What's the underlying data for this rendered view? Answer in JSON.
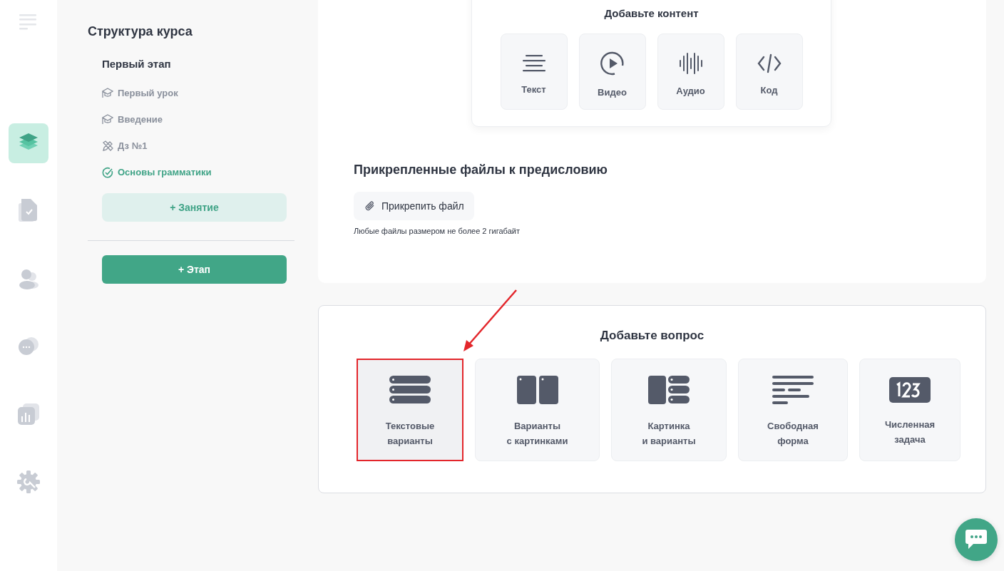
{
  "nav": [
    {
      "kind": "menu",
      "selected": false
    },
    {
      "kind": "layers",
      "selected": true
    },
    {
      "kind": "document",
      "selected": false
    },
    {
      "kind": "users",
      "selected": false
    },
    {
      "kind": "chat",
      "selected": false
    },
    {
      "kind": "chart",
      "selected": false
    },
    {
      "kind": "settings",
      "selected": false
    }
  ],
  "structure": {
    "title": "Структура курса",
    "stage": "Первый этап",
    "lessons": [
      {
        "kind": "lesson",
        "label": "Первый урок",
        "selected": false
      },
      {
        "kind": "lesson",
        "label": "Введение",
        "selected": false
      },
      {
        "kind": "homework",
        "label": "Дз №1",
        "selected": false
      },
      {
        "kind": "done",
        "label": "Основы грамматики",
        "selected": true
      }
    ],
    "add_lesson": "+ Занятие",
    "add_stage": "+ Этап"
  },
  "content": {
    "title": "Добавьте контент",
    "tiles": [
      {
        "kind": "text",
        "label": "Текст"
      },
      {
        "kind": "video",
        "label": "Видео"
      },
      {
        "kind": "audio",
        "label": "Аудио"
      },
      {
        "kind": "code",
        "label": "Код"
      }
    ]
  },
  "attachments": {
    "title": "Прикрепленные файлы к предисловию",
    "button": "Прикрепить файл",
    "hint": "Любые файлы размером не более 2 гигабайт"
  },
  "questions": {
    "title": "Добавьте вопрос",
    "options": [
      {
        "kind": "text-options",
        "label": "Текстовые варианты",
        "highlighted": true
      },
      {
        "kind": "image-options",
        "label": "Варианты с картинками",
        "highlighted": false
      },
      {
        "kind": "image-and-options",
        "label": "Картинка и варианты",
        "highlighted": false
      },
      {
        "kind": "free-form",
        "label": "Свободная форма",
        "highlighted": false
      },
      {
        "kind": "numeric",
        "label": "Численная задача",
        "highlighted": false
      }
    ]
  }
}
